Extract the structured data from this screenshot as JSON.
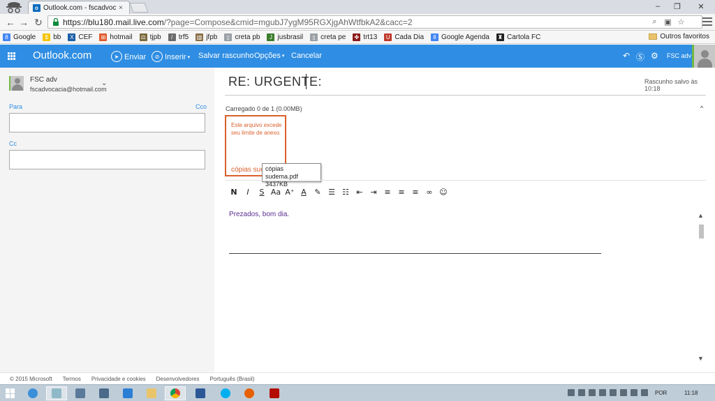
{
  "browser": {
    "tab_title": "Outlook.com - fscadvocac",
    "tab_close": "×",
    "url_host": "https://blu180.mail.live.com",
    "url_path": "/?page=Compose&cmid=mgubJ7ygM95RGXjgAhWtfbkA2&cacc=2",
    "bookmarks": [
      {
        "label": "Google",
        "icon": "google-icon",
        "color": "#4285f4",
        "glyph": "8"
      },
      {
        "label": "bb",
        "icon": "bb-icon",
        "color": "#f5c400",
        "glyph": "$"
      },
      {
        "label": "CEF",
        "icon": "cef-icon",
        "color": "#1b5fa8",
        "glyph": "X"
      },
      {
        "label": "hotmail",
        "icon": "windows-icon",
        "color": "#e05a2b",
        "glyph": "⊞"
      },
      {
        "label": "tjpb",
        "icon": "scale-icon",
        "color": "#7a6a3c",
        "glyph": "⚖"
      },
      {
        "label": "trf5",
        "icon": "trf5-icon",
        "color": "#6b6b6b",
        "glyph": "/"
      },
      {
        "label": "jfpb",
        "icon": "building-icon",
        "color": "#8a6d45",
        "glyph": "▥"
      },
      {
        "label": "creta pb",
        "icon": "page-icon",
        "color": "#9aa0a6",
        "glyph": "▯"
      },
      {
        "label": "jusbrasil",
        "icon": "jusbrasil-icon",
        "color": "#3a7d2c",
        "glyph": "J"
      },
      {
        "label": "creta pe",
        "icon": "page-icon",
        "color": "#9aa0a6",
        "glyph": "▯"
      },
      {
        "label": "trt13",
        "icon": "trt13-icon",
        "color": "#8b1a1a",
        "glyph": "✤"
      },
      {
        "label": "Cada Dia",
        "icon": "shield-icon",
        "color": "#c0392b",
        "glyph": "U"
      },
      {
        "label": "Google Agenda",
        "icon": "google-icon",
        "color": "#4285f4",
        "glyph": "8"
      },
      {
        "label": "Cartola FC",
        "icon": "hat-icon",
        "color": "#222222",
        "glyph": "♜"
      }
    ],
    "other_bookmarks": "Outros favoritos"
  },
  "outlook": {
    "brand": "Outlook.com",
    "accent": "#2f8ee3",
    "commands": {
      "send": "Enviar",
      "insert": "Inserir",
      "save_draft": "Salvar rascunho",
      "options": "Opções",
      "cancel": "Cancelar"
    },
    "user_name": "FSC adv"
  },
  "sender": {
    "name": "FSC adv",
    "email": "fscadvocacia@hotmail.com"
  },
  "fields": {
    "to_label": "Para",
    "cc_toggle": "Cco",
    "cc_label": "Cc"
  },
  "compose": {
    "subject": "RE: URGENTE:",
    "saved_status": "Rascunho salvo às 10:18",
    "attachment_status": "Carregado 0 de 1 (0.00MB)",
    "attachment_warning": "Este arquivo excede seu limite de anexo.",
    "attachment_name": "cópias sudema.pdf",
    "attachment_name_visible": "cópias suc",
    "tooltip_name": "cópias sudema.pdf",
    "tooltip_size": "3437KB",
    "body": "Prezados, bom dia."
  },
  "formatting": [
    "N",
    "I",
    "S",
    "Aa",
    "A²",
    "A",
    "pen",
    "numbered-list",
    "bullet-list",
    "decrease-indent",
    "increase-indent",
    "align-left",
    "align-center",
    "align-right",
    "link",
    "emoji"
  ],
  "footer": {
    "copyright": "© 2015 Microsoft",
    "terms": "Termos",
    "privacy": "Privacidade e cookies",
    "developers": "Desenvolvedores",
    "language": "Português (Brasil)"
  },
  "taskbar": {
    "language": "POR",
    "time": "11:18"
  }
}
